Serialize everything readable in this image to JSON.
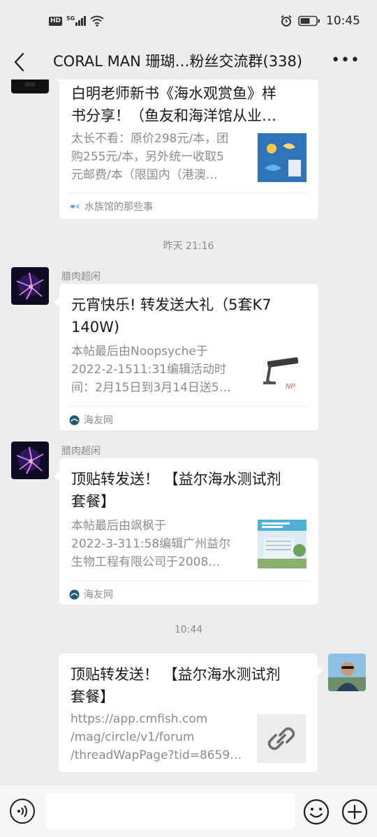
{
  "status_bar": {
    "hd": "HD",
    "network": "5G",
    "time": "10:45"
  },
  "header": {
    "title": "CORAL MAN 珊瑚…粉丝交流群(338)"
  },
  "messages": [
    {
      "title_lines": [
        "白明老师新书《海水观赏鱼》样",
        "书分享！（鱼友和海洋馆从业…"
      ],
      "desc_lines": [
        "太长不看：原价298元/本，团",
        "购255元/本，另外统一收取5",
        "元邮费/本（限国内（港澳…"
      ],
      "source": "水族馆的那些事",
      "source_icon": "aquarium-logo-icon",
      "thumb_icon": "book-cover-icon"
    },
    {
      "sender": "腊肉超闲",
      "title_lines": [
        "元宵快乐! 转发送大礼（5套K7",
        "140W)"
      ],
      "desc_lines": [
        "本帖最后由Noopsyche于",
        "2022-2-1511:31编辑活动时",
        "间：2月15日到3月14日送5…"
      ],
      "source": "海友网",
      "source_icon": "haiyou-logo-icon",
      "thumb_icon": "led-lamp-icon"
    },
    {
      "sender": "腊肉超闲",
      "title_lines": [
        "顶贴转发送！ 【益尔海水测试剂",
        "套餐】"
      ],
      "desc_lines": [
        "本帖最后由飒枫于",
        "2022-3-311:58编辑广州益尔",
        "生物工程有限公司于2008…"
      ],
      "source": "海友网",
      "source_icon": "haiyou-logo-icon",
      "thumb_icon": "building-photo-icon"
    },
    {
      "title_lines": [
        "顶贴转发送！ 【益尔海水测试剂",
        "套餐】"
      ],
      "desc_lines": [
        "https://app.cmfish.com",
        "/mag/circle/v1/forum",
        "/threadWapPage?tid=8659…"
      ],
      "thumb_icon": "link-icon"
    }
  ],
  "timestamps": [
    "昨天 21:16",
    "10:44"
  ],
  "input_bar": {
    "placeholder": ""
  },
  "colors": {
    "background": "#ededed",
    "bubble": "#ffffff",
    "muted": "#8c8c8c"
  }
}
